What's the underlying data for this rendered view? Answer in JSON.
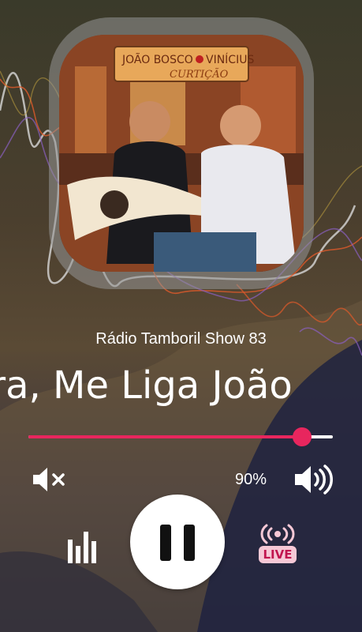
{
  "player": {
    "station_name": "Rádio Tamboril Show 83",
    "now_playing": "ora, Me Liga João",
    "album_text_1": "JOÃO BOSCO",
    "album_text_2": "VINÍCIUS",
    "album_text_3": "CURTIÇÃO",
    "progress_fraction": 0.9,
    "volume_text": "90%",
    "live_label": "LIVE",
    "accent_color": "#e8265e",
    "state": "playing"
  },
  "icons": {
    "mute": "mute-icon",
    "volume": "volume-high-icon",
    "equalizer": "equalizer-icon",
    "pause": "pause-icon",
    "live": "live-broadcast-icon"
  }
}
